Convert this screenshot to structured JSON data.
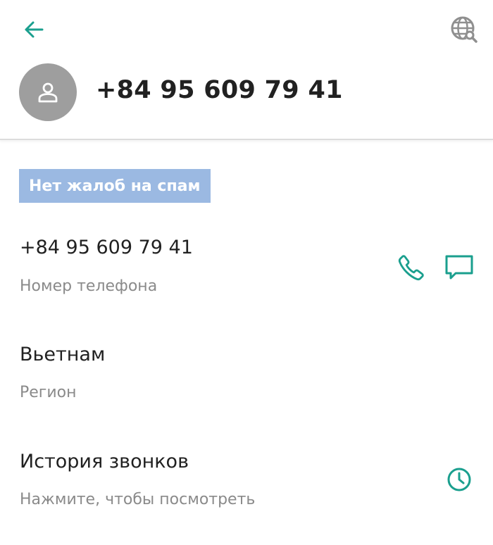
{
  "header": {
    "back_icon": "arrow-back-icon",
    "globe_icon": "globe-search-icon",
    "avatar_icon": "person-icon",
    "title": "+84 95 609 79 41"
  },
  "spam_badge": "Нет жалоб на спам",
  "phone_row": {
    "value": "+84 95 609 79 41",
    "label": "Номер телефона",
    "call_icon": "phone-icon",
    "message_icon": "message-icon"
  },
  "region_row": {
    "value": "Вьетнам",
    "label": "Регион"
  },
  "history_row": {
    "value": "История звонков",
    "label": "Нажмите, чтобы посмотреть",
    "icon": "clock-icon"
  },
  "colors": {
    "accent": "#1a9f8e",
    "badge": "#9bb9e2",
    "avatar": "#9e9e9e",
    "secondary_text": "#8a8a8a",
    "globe": "#8f8f8f"
  }
}
